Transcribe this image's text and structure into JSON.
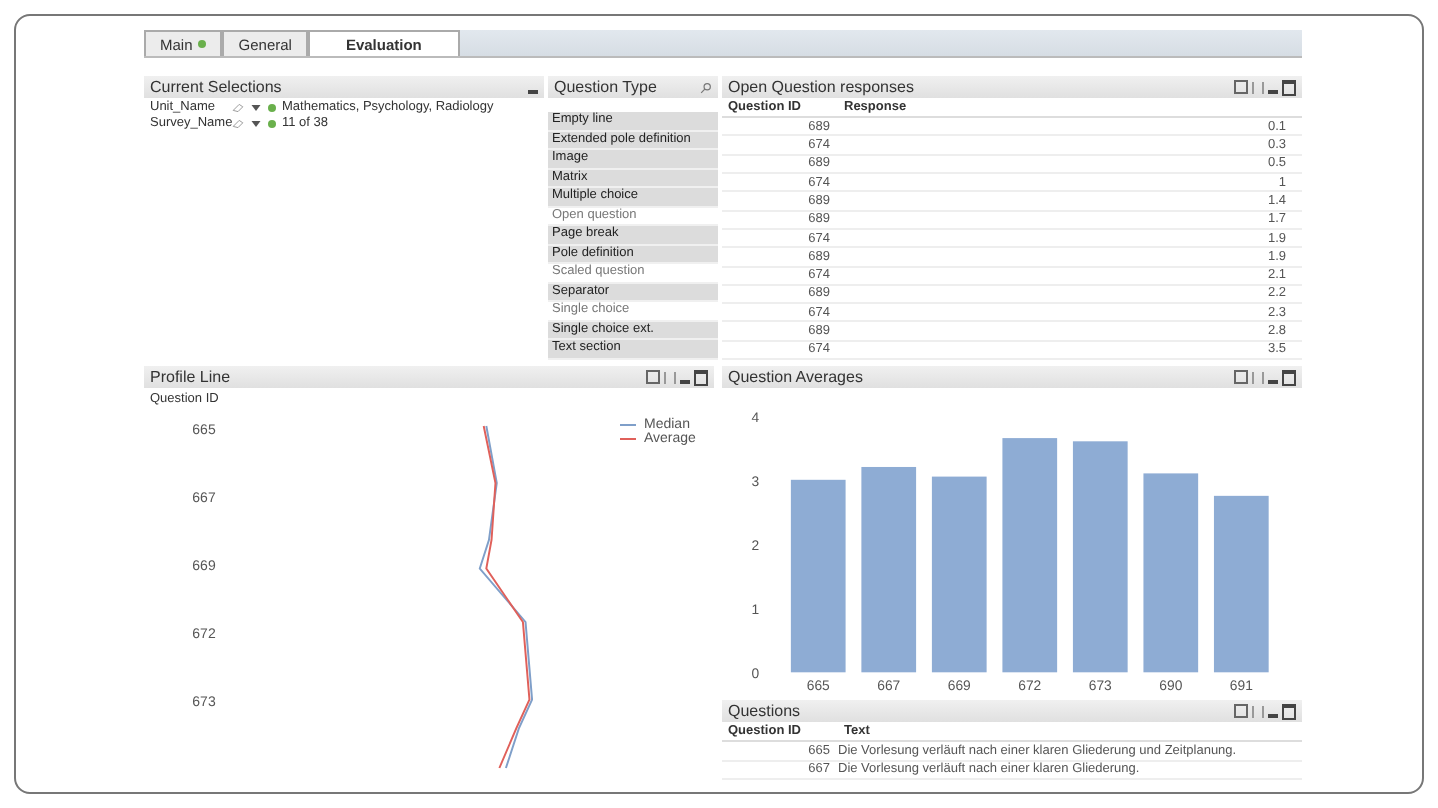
{
  "tabs": [
    {
      "label": "Main",
      "selected": false,
      "dot": true
    },
    {
      "label": "General",
      "selected": false,
      "dot": false
    },
    {
      "label": "Evaluation",
      "selected": true,
      "dot": false
    }
  ],
  "current_selections": {
    "title": "Current Selections",
    "rows": [
      {
        "field": "Unit_Name",
        "value": "Mathematics, Psychology, Radiology"
      },
      {
        "field": "Survey_Name",
        "value": "11 of 38"
      }
    ]
  },
  "question_type": {
    "title": "Question Type",
    "items": [
      {
        "label": "Empty line",
        "excluded": true
      },
      {
        "label": "Extended pole definition",
        "excluded": true
      },
      {
        "label": "Image",
        "excluded": true
      },
      {
        "label": "Matrix",
        "excluded": true
      },
      {
        "label": "Multiple choice",
        "excluded": true
      },
      {
        "label": "Open question",
        "excluded": false
      },
      {
        "label": "Page break",
        "excluded": true
      },
      {
        "label": "Pole definition",
        "excluded": true
      },
      {
        "label": "Scaled question",
        "excluded": false
      },
      {
        "label": "Separator",
        "excluded": true
      },
      {
        "label": "Single choice",
        "excluded": false
      },
      {
        "label": "Single choice ext.",
        "excluded": true
      },
      {
        "label": "Text section",
        "excluded": true
      }
    ]
  },
  "open_responses": {
    "title": "Open Question responses",
    "columns": [
      "Question ID",
      "Response"
    ],
    "rows": [
      [
        "689",
        "0.1"
      ],
      [
        "674",
        "0.3"
      ],
      [
        "689",
        "0.5"
      ],
      [
        "674",
        "1"
      ],
      [
        "689",
        "1.4"
      ],
      [
        "689",
        "1.7"
      ],
      [
        "674",
        "1.9"
      ],
      [
        "689",
        "1.9"
      ],
      [
        "674",
        "2.1"
      ],
      [
        "689",
        "2.2"
      ],
      [
        "674",
        "2.3"
      ],
      [
        "689",
        "2.8"
      ],
      [
        "674",
        "3.5"
      ]
    ]
  },
  "profile_line": {
    "title": "Profile Line",
    "axis_title": "Question ID",
    "axis_labels": [
      "665",
      "667",
      "669",
      "672",
      "673"
    ],
    "legend": [
      {
        "name": "Median",
        "color": "#7f9fc9"
      },
      {
        "name": "Average",
        "color": "#e0605a"
      }
    ]
  },
  "question_averages": {
    "title": "Question Averages",
    "chart_data": {
      "type": "bar",
      "categories": [
        "665",
        "667",
        "669",
        "672",
        "673",
        "690",
        "691"
      ],
      "series": [
        {
          "color": "#8eacd4",
          "values": [
            3.0,
            3.2,
            3.05,
            3.65,
            3.6,
            3.1,
            2.75
          ]
        }
      ],
      "ylim": [
        0,
        4
      ],
      "yticks": [
        0,
        1,
        2,
        3,
        4
      ]
    }
  },
  "questions": {
    "title": "Questions",
    "columns": [
      "Question ID",
      "Text"
    ],
    "rows": [
      [
        "665",
        "Die Vorlesung verläuft nach einer klaren Gliederung und Zeitplanung."
      ],
      [
        "667",
        "Die Vorlesung verläuft nach einer klaren Gliederung."
      ]
    ]
  }
}
